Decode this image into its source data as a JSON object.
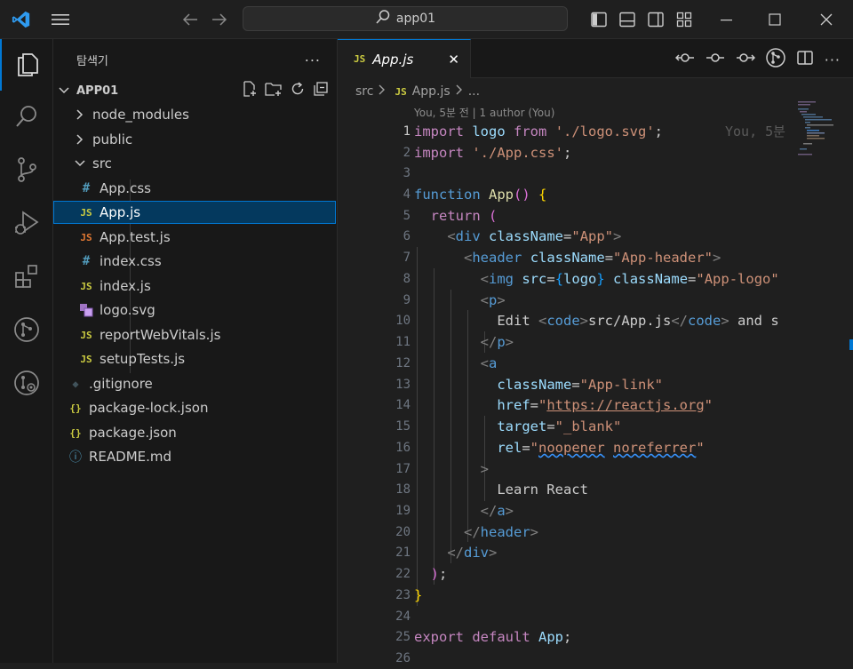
{
  "titlebar": {
    "search_text": "app01"
  },
  "explorer": {
    "title": "탐색기",
    "more": "...",
    "root": "APP01",
    "items": [
      {
        "label": "node_modules",
        "type": "folder",
        "icon": "chevron-right"
      },
      {
        "label": "public",
        "type": "folder",
        "icon": "chevron-right"
      },
      {
        "label": "src",
        "type": "folder",
        "icon": "chevron-down"
      },
      {
        "label": "App.css",
        "type": "css",
        "icon": "#"
      },
      {
        "label": "App.js",
        "type": "js",
        "icon": "JS"
      },
      {
        "label": "App.test.js",
        "type": "test",
        "icon": "JS"
      },
      {
        "label": "index.css",
        "type": "css",
        "icon": "#"
      },
      {
        "label": "index.js",
        "type": "js",
        "icon": "JS"
      },
      {
        "label": "logo.svg",
        "type": "svg",
        "icon": "svg"
      },
      {
        "label": "reportWebVitals.js",
        "type": "js",
        "icon": "JS"
      },
      {
        "label": "setupTests.js",
        "type": "js",
        "icon": "JS"
      },
      {
        "label": ".gitignore",
        "type": "git",
        "icon": "◆"
      },
      {
        "label": "package-lock.json",
        "type": "json",
        "icon": "{}"
      },
      {
        "label": "package.json",
        "type": "json",
        "icon": "{}"
      },
      {
        "label": "README.md",
        "type": "info",
        "icon": "ⓘ"
      }
    ]
  },
  "editor": {
    "tab": {
      "icon": "JS",
      "label": "App.js",
      "close": "✕"
    },
    "breadcrumb": {
      "folder": "src",
      "icon": "JS",
      "file": "App.js",
      "more": "..."
    },
    "blame": "You, 5분 전 | 1 author (You)",
    "ghost_blame": "You, 5분",
    "line_numbers": [
      "1",
      "2",
      "3",
      "4",
      "5",
      "6",
      "7",
      "8",
      "9",
      "10",
      "11",
      "12",
      "13",
      "14",
      "15",
      "16",
      "17",
      "18",
      "19",
      "20",
      "21",
      "22",
      "23",
      "24",
      "25",
      "26"
    ]
  },
  "colors": {
    "accent": "#0078d4",
    "js": "#cbcb41",
    "test": "#e37933",
    "css": "#519aba",
    "json": "#cbcb41"
  }
}
